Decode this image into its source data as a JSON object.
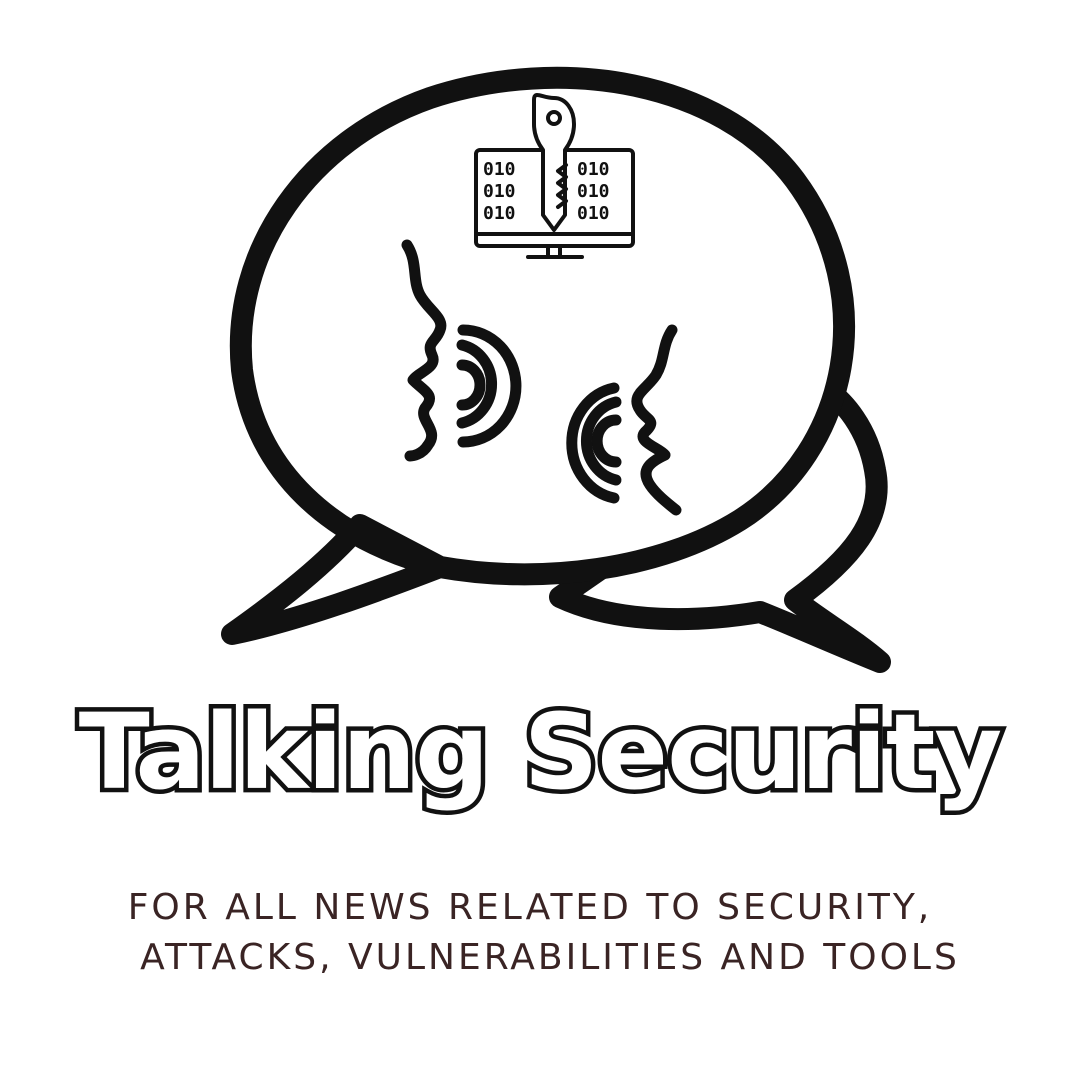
{
  "logo": {
    "title": "Talking Security",
    "tagline_line1": "FOR ALL NEWS RELATED TO SECURITY,",
    "tagline_line2": "ATTACKS, VULNERABILITIES AND TOOLS",
    "binary_text": "010",
    "icons": [
      "chat-bubbles-icon",
      "monitor-key-icon",
      "talking-faces-icon"
    ]
  },
  "colors": {
    "outline": "#111111",
    "background": "#ffffff",
    "tagline": "#3a2424"
  }
}
